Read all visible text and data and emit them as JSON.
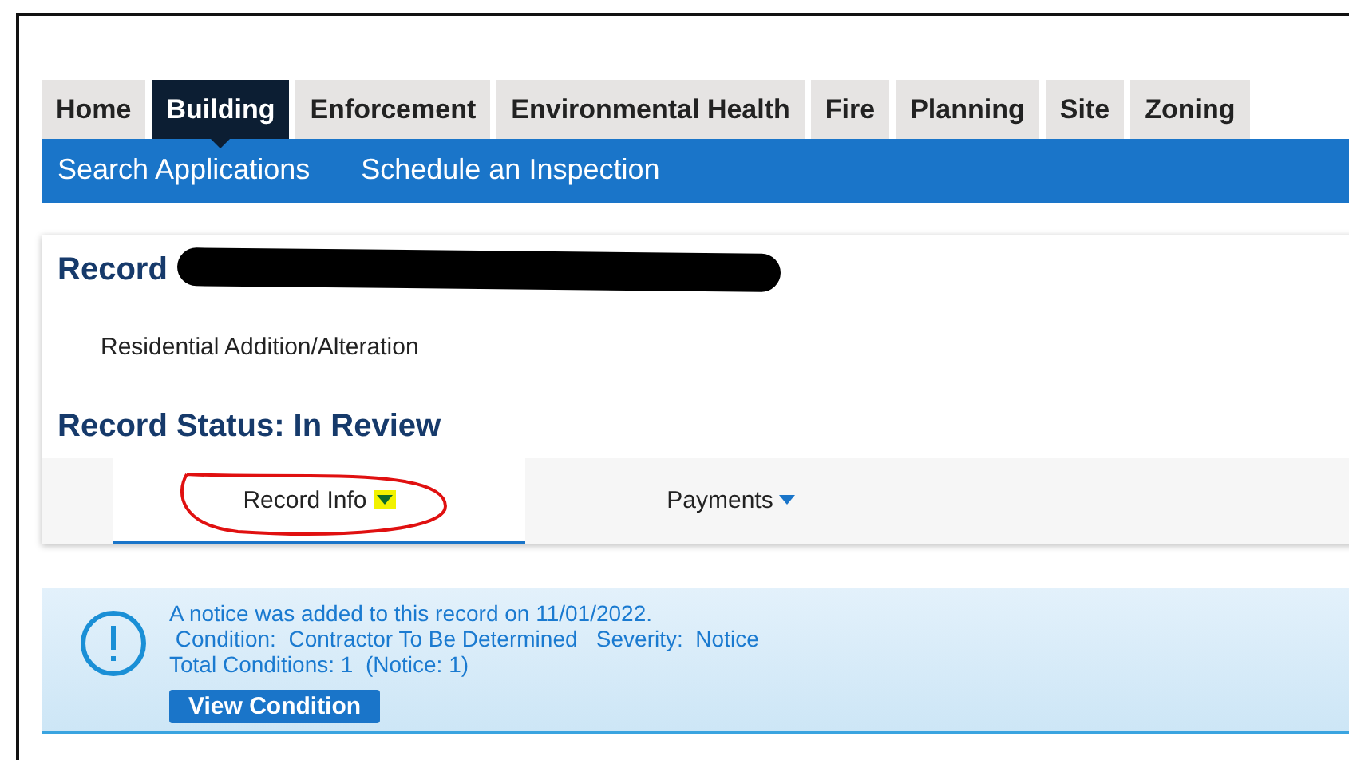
{
  "tabs": [
    {
      "label": "Home",
      "selected": false
    },
    {
      "label": "Building",
      "selected": true
    },
    {
      "label": "Enforcement",
      "selected": false
    },
    {
      "label": "Environmental Health",
      "selected": false
    },
    {
      "label": "Fire",
      "selected": false
    },
    {
      "label": "Planning",
      "selected": false
    },
    {
      "label": "Site",
      "selected": false
    },
    {
      "label": "Zoning",
      "selected": false
    }
  ],
  "subnav": [
    "Search Applications",
    "Schedule an Inspection"
  ],
  "record": {
    "title": "Record",
    "type": "Residential Addition/Alteration",
    "status": "Record Status: In Review"
  },
  "record_tabs": [
    {
      "label": "Record Info",
      "selected": true,
      "annotated": true
    },
    {
      "label": "Payments",
      "selected": false,
      "annotated": false
    }
  ],
  "notice": {
    "lines": [
      "A notice was added to this record on 11/01/2022.",
      " Condition:  Contractor To Be Determined   Severity:  Notice",
      "Total Conditions: 1  (Notice: 1)"
    ],
    "button": "View Condition"
  }
}
